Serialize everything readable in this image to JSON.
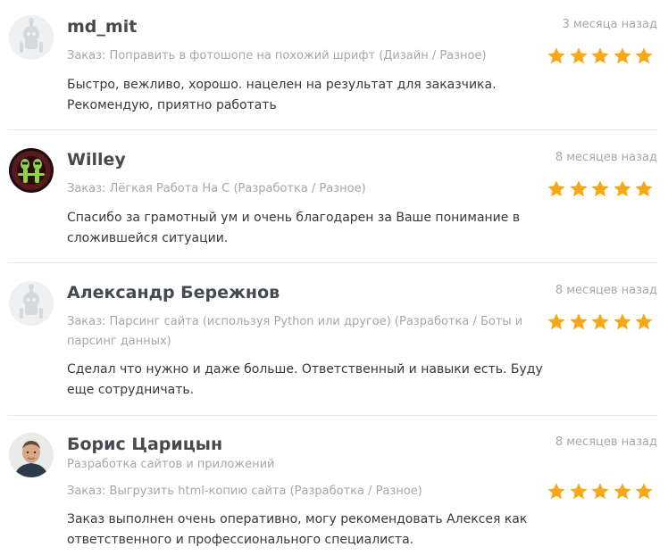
{
  "colors": {
    "star": "#f6a817",
    "name": "#444a4f",
    "muted": "#a3a8ac",
    "text": "#35393d",
    "divider": "#e4e6e8"
  },
  "reviews": [
    {
      "avatar_icon": "default-robot-avatar-icon",
      "name": "md_mit",
      "time": "3 месяца назад",
      "order": "Заказ: Поправить в фотошопе на похожий шрифт (Дизайн / Разное)",
      "rating": 5,
      "text": "Быстро, вежливо, хорошо. нацелен на результат для заказчика. Рекомендую, приятно работать"
    },
    {
      "avatar_icon": "alien-avatar-icon",
      "name": "Willey",
      "time": "8 месяцев назад",
      "order": "Заказ: Лёгкая Работа На С (Разработка / Разное)",
      "rating": 5,
      "text": "Спасибо за грамотный ум и очень благодарен за Ваше понимание в сложившейся ситуации."
    },
    {
      "avatar_icon": "default-robot-avatar-icon",
      "name": "Александр Бережнов",
      "time": "8 месяцев назад",
      "order": "Заказ: Парсинг сайта (используя Python или другое) (Разработка / Боты и парсинг данных)",
      "rating": 5,
      "text": "Сделал что нужно и даже больше. Ответственный и навыки есть. Буду еще сотрудничать."
    },
    {
      "avatar_icon": "user-photo-avatar-icon",
      "name": "Борис Царицын",
      "subtitle": "Разработка сайтов и приложений",
      "time": "8 месяцев назад",
      "order": "Заказ: Выгрузить html-копию сайта (Разработка / Разное)",
      "rating": 5,
      "text": "Заказ выполнен очень оперативно, могу рекомендовать Алексея как ответственного и профессионального специалиста."
    }
  ]
}
